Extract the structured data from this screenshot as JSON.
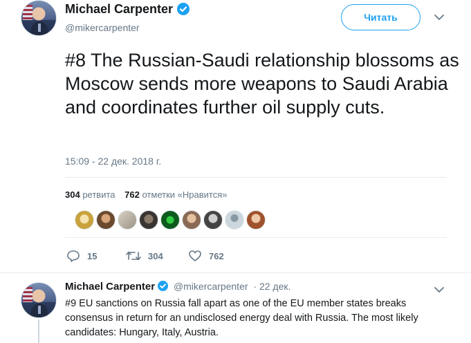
{
  "tweet": {
    "author_name": "Michael Carpenter",
    "author_handle": "@mikercarpenter",
    "follow_label": "Читать",
    "text": "#8 The Russian-Saudi relationship blossoms as Moscow sends more weapons to Saudi Arabia and coordinates further oil supply cuts.",
    "timestamp": "15:09 - 22 дек. 2018 г.",
    "retweets_count": "304",
    "retweets_label": "ретвита",
    "likes_count": "762",
    "likes_label": "отметки «Нравится»",
    "actions": {
      "reply_count": "15",
      "retweet_count": "304",
      "like_count": "762"
    }
  },
  "reply": {
    "author_name": "Michael Carpenter",
    "author_handle": "@mikercarpenter",
    "date": "· 22 дек.",
    "text": "#9 EU sanctions on Russia fall apart as one of the EU member states breaks consensus in return for an undisclosed energy deal with Russia. The most likely candidates: Hungary, Italy, Austria."
  },
  "colors": {
    "accent": "#1da1f2",
    "secondary_text": "#657786",
    "divider": "#e6ecf0"
  },
  "icons": [
    "verified-badge-icon",
    "chevron-down-icon",
    "reply-icon",
    "retweet-icon",
    "like-icon"
  ]
}
